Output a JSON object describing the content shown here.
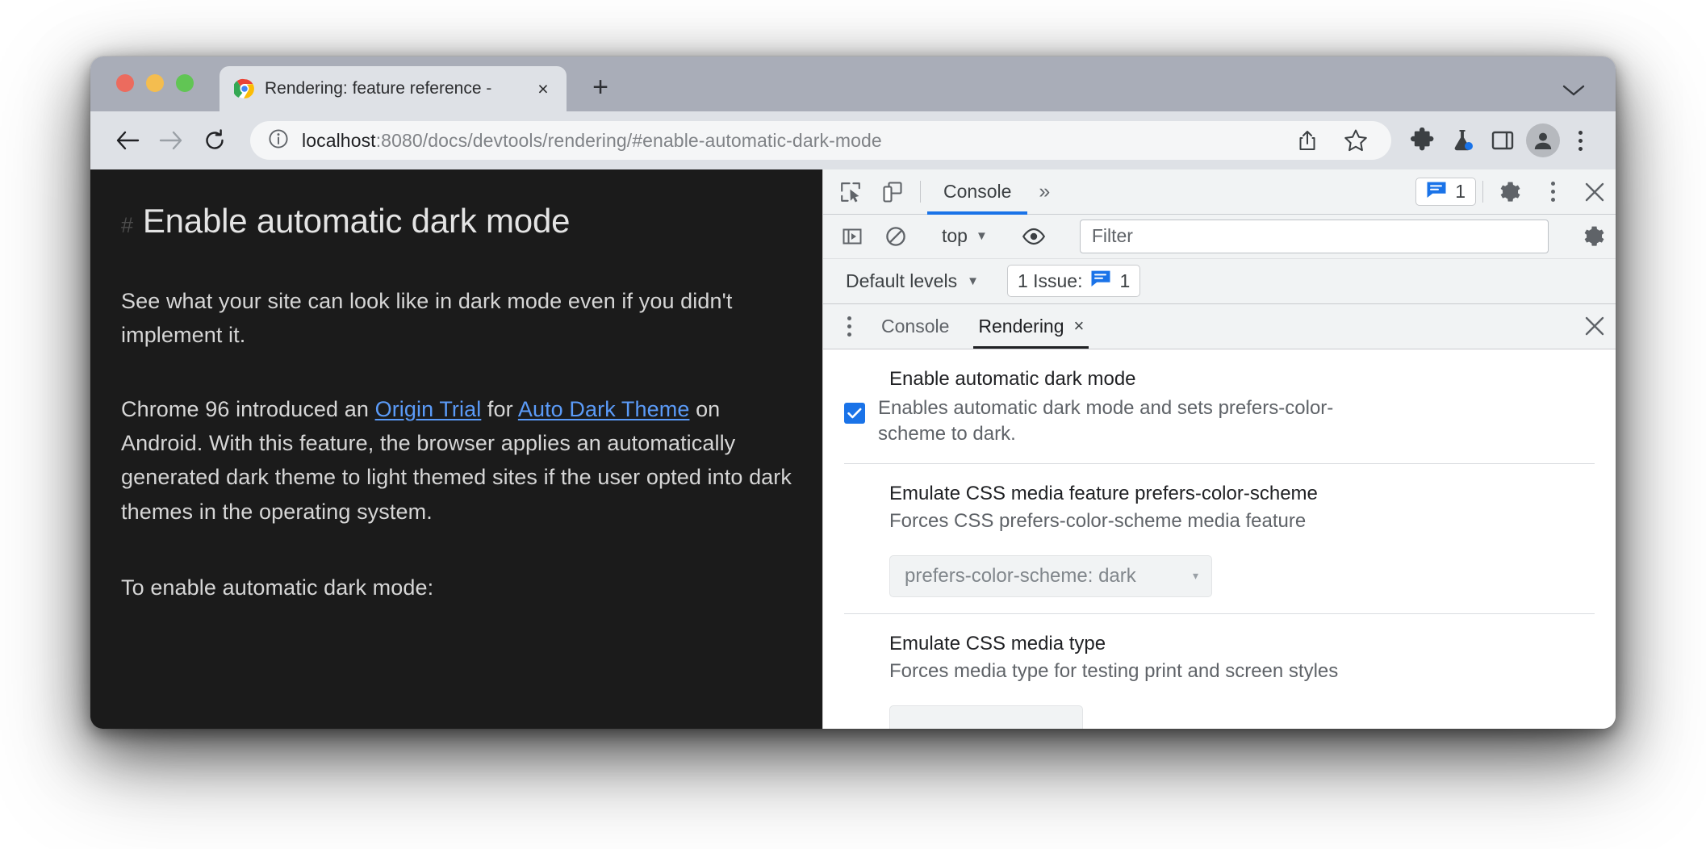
{
  "browser": {
    "tab": {
      "title": "Rendering: feature reference -",
      "favicon": "chrome-logo-icon",
      "close_label": "×"
    },
    "new_tab_label": "+",
    "tabstrip_caret": "⌄",
    "nav": {
      "back": "←",
      "forward": "→",
      "reload": "↻"
    },
    "omnibox": {
      "info_icon": "page-info-icon",
      "host": "localhost",
      "path": ":8080/docs/devtools/rendering/#enable-automatic-dark-mode",
      "share_icon": "share-icon",
      "bookmark_icon": "star-icon"
    },
    "actions": [
      {
        "name": "extensions-icon",
        "label": "Extensions"
      },
      {
        "name": "experiments-flask-icon",
        "label": "Experiments"
      },
      {
        "name": "side-panel-icon",
        "label": "Side panel"
      },
      {
        "name": "profile-avatar",
        "label": "Profile"
      },
      {
        "name": "chrome-menu-icon",
        "label": "Customize and control Google Chrome"
      }
    ]
  },
  "page": {
    "hash_anchor": "#",
    "heading": "Enable automatic dark mode",
    "paragraph1": "See what your site can look like in dark mode even if you didn't implement it.",
    "paragraph2": {
      "before_link1": "Chrome 96 introduced an ",
      "link1": "Origin Trial",
      "between_links": " for ",
      "link2": "Auto Dark Theme",
      "after_links": " on Android. With this feature, the browser applies an automatically generated dark theme to light themed sites if the user opted into dark themes in the operating system."
    },
    "paragraph3": "To enable automatic dark mode:"
  },
  "devtools": {
    "main_toolbar": {
      "inspect_icon": "inspect-element-icon",
      "device_icon": "device-toolbar-icon",
      "tabs": [
        {
          "label": "Console",
          "active": true
        }
      ],
      "more_tabs": "»",
      "issues_chip": {
        "icon": "issues-message-icon",
        "count": "1"
      },
      "settings_icon": "gear-icon",
      "kebab_icon": "more-options-icon",
      "close_icon": "close-icon"
    },
    "console_toolbar": {
      "sidebar_icon": "console-sidebar-icon",
      "clear_icon": "clear-console-icon",
      "context": "top",
      "context_caret": "▼",
      "eye_icon": "live-expression-icon",
      "filter_placeholder": "Filter",
      "filter_value": "",
      "settings_icon": "console-settings-icon"
    },
    "levels_row": {
      "levels_label": "Default levels",
      "levels_caret": "▼",
      "issues_label": "1 Issue:",
      "issues_icon": "issues-message-icon",
      "issues_count": "1"
    },
    "drawer": {
      "kebab_icon": "drawer-more-icon",
      "tabs": [
        {
          "label": "Console",
          "active": false,
          "closable": false
        },
        {
          "label": "Rendering",
          "active": true,
          "closable": true,
          "close_label": "×"
        }
      ],
      "close_icon": "close-drawer-icon"
    },
    "rendering": {
      "sections": [
        {
          "title": "Enable automatic dark mode",
          "description": "Enables automatic dark mode and sets prefers-color-scheme to dark.",
          "checkbox": true,
          "checked": true
        },
        {
          "title": "Emulate CSS media feature prefers-color-scheme",
          "description": "Forces CSS prefers-color-scheme media feature",
          "checkbox": false,
          "select_value": "prefers-color-scheme: dark",
          "select_caret": "▾"
        },
        {
          "title": "Emulate CSS media type",
          "description": "Forces media type for testing print and screen styles",
          "checkbox": false
        }
      ]
    }
  },
  "colors": {
    "accent_blue": "#1a73e8",
    "link_blue": "#5b9bf8",
    "tabstrip": "#a9adb8",
    "toolbar": "#dee1e6",
    "page_bg": "#1b1b1b",
    "devtools_bg": "#f1f3f4"
  }
}
